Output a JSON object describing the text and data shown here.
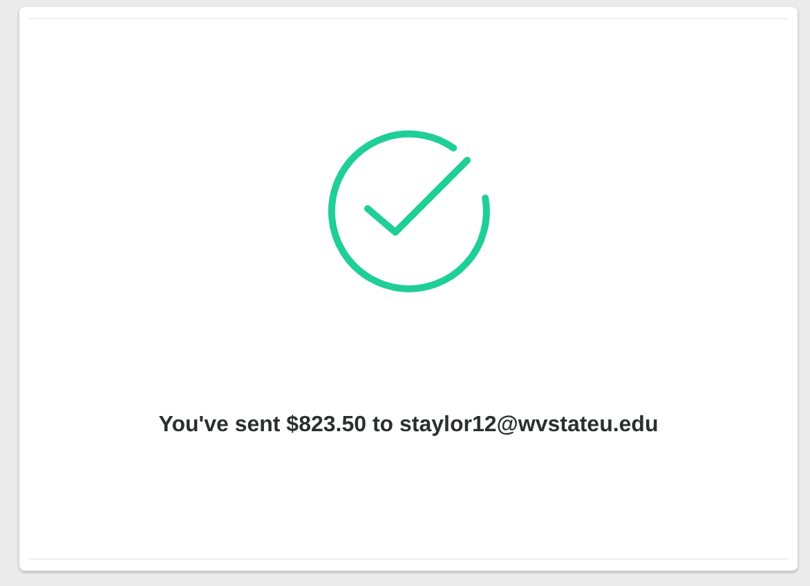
{
  "confirmation": {
    "message": "You've sent $823.50 to staylor12@wvstateu.edu"
  }
}
